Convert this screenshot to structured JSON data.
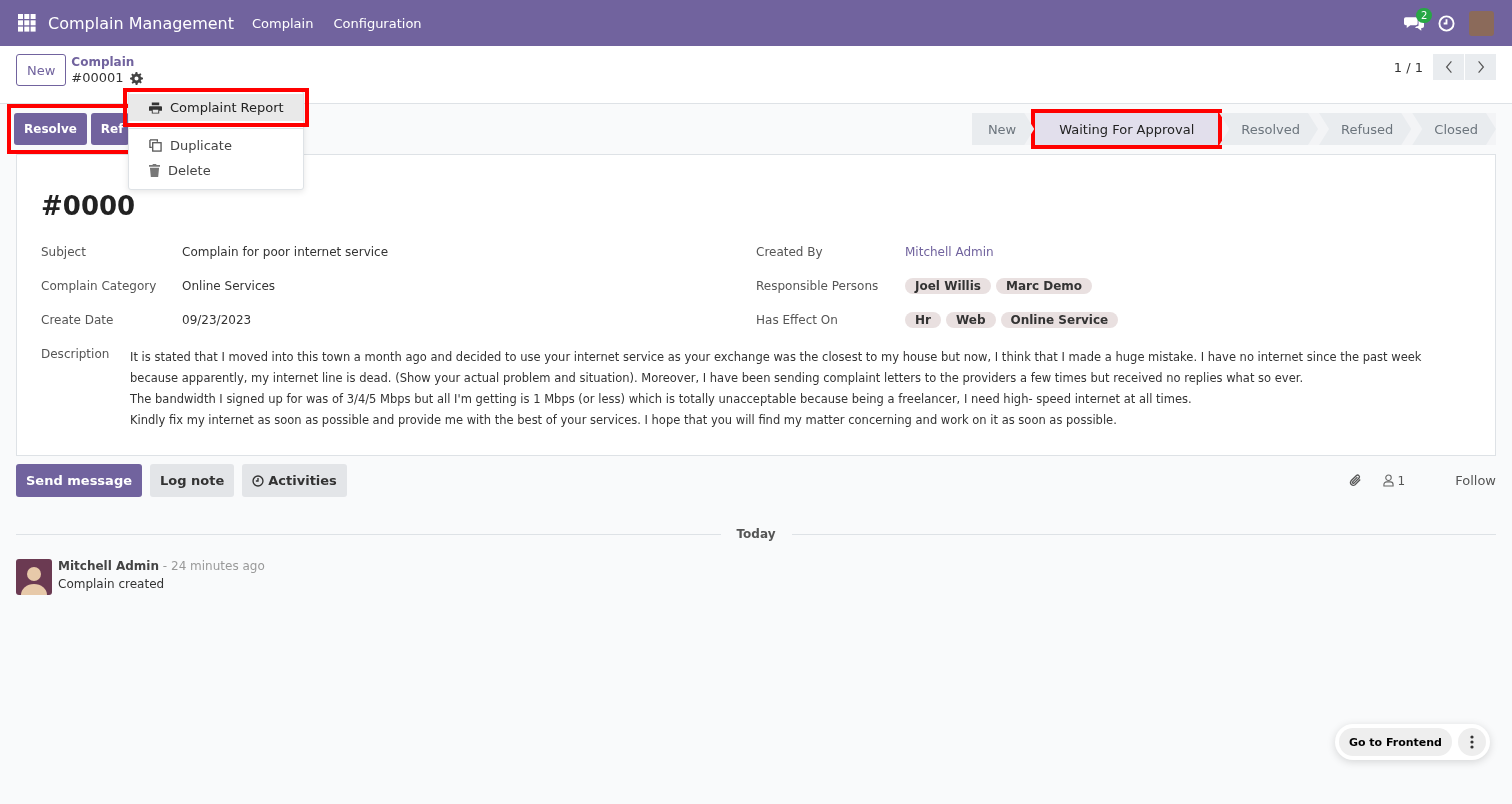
{
  "navbar": {
    "app_name": "Complain Management",
    "menus": [
      "Complain",
      "Configuration"
    ],
    "message_count": "2"
  },
  "control_panel": {
    "new_button": "New",
    "breadcrumb": "Complain",
    "record": "#00001",
    "pager": "1 / 1"
  },
  "gear_menu": [
    {
      "label": "Complaint Report",
      "kind": "print",
      "selected": true
    },
    {
      "label": "Duplicate",
      "kind": "copy",
      "selected": false
    },
    {
      "label": "Delete",
      "kind": "trash",
      "selected": false
    }
  ],
  "actions": [
    {
      "label": "Resolve"
    },
    {
      "label": "Ref"
    }
  ],
  "stages": [
    {
      "label": "New",
      "selected": false
    },
    {
      "label": "Waiting For Approval",
      "selected": true
    },
    {
      "label": "Resolved",
      "selected": false
    },
    {
      "label": "Refused",
      "selected": false
    },
    {
      "label": "Closed",
      "selected": false
    }
  ],
  "form": {
    "title": "#0000",
    "left_fields": [
      {
        "label": "Subject",
        "value": "Complain for poor internet service"
      },
      {
        "label": "Complain Category",
        "value": "Online Services"
      },
      {
        "label": "Create Date",
        "value": "09/23/2023"
      }
    ],
    "created_by": {
      "label": "Created By",
      "value": "Mitchell Admin"
    },
    "tag_fields": [
      {
        "label": "Responsible Persons",
        "tags": [
          "Joel Willis",
          "Marc Demo"
        ]
      },
      {
        "label": "Has Effect On",
        "tags": [
          "Hr",
          "Web",
          "Online Service"
        ]
      }
    ],
    "description": {
      "label": "Description",
      "lines": [
        "It is stated that I moved into this town a month ago and decided to use your internet service as your exchange was the closest to my house but now, I think that I made a huge mistake. I have no internet since the past week because apparently, my internet line is dead. (Show your actual problem and situation). Moreover, I have been sending complaint letters to the providers a few times but received no replies what so ever.",
        "The bandwidth I signed up for was of 3/4/5 Mbps but all I'm getting is 1 Mbps (or less) which is totally unacceptable because being a freelancer, I need high- speed internet at all times.",
        "Kindly fix my internet as soon as possible and provide me with the best of your services. I hope that you will find my matter concerning and work on it as soon as possible."
      ]
    }
  },
  "chatter": {
    "buttons": [
      {
        "label": "Send message",
        "kind": "primary"
      },
      {
        "label": "Log note",
        "kind": "plain"
      },
      {
        "label": "Activities",
        "kind": "clock"
      }
    ],
    "followers": "1",
    "follow": "Follow",
    "date_separator": "Today",
    "messages": [
      {
        "author": "Mitchell Admin",
        "time": "- 24 minutes ago",
        "body": "Complain created"
      }
    ]
  },
  "frontend_button": "Go to Frontend"
}
